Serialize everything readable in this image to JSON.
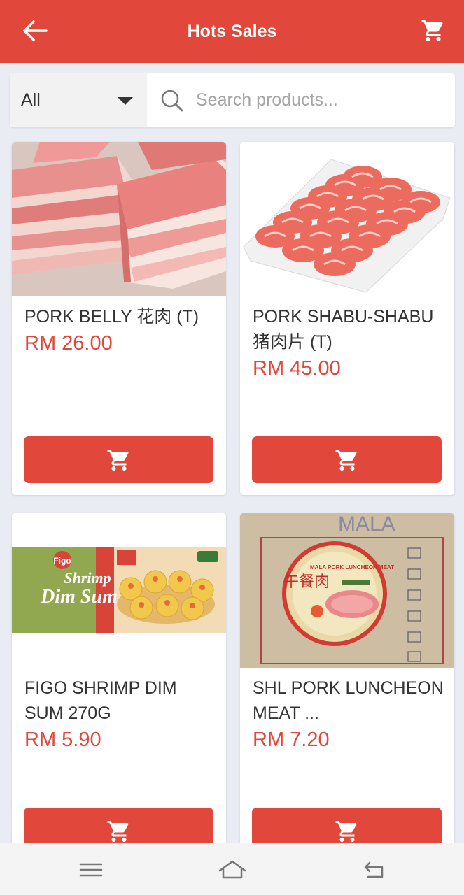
{
  "header": {
    "title": "Hots Sales",
    "back_icon": "arrow-left-icon",
    "cart_icon": "shopping-cart-icon"
  },
  "filter": {
    "category_selected": "All",
    "search_placeholder": "Search products..."
  },
  "products": [
    {
      "name": "PORK BELLY 花肉 (T)",
      "price": "RM 26.00"
    },
    {
      "name": "PORK SHABU-SHABU 猪肉片 (T)",
      "price": "RM 45.00"
    },
    {
      "name": "FIGO SHRIMP DIM SUM  270G",
      "price": "RM 5.90"
    },
    {
      "name": "SHL PORK LUNCHEON MEAT ...",
      "price": "RM 7.20"
    }
  ],
  "product_images": {
    "figo_label_line1": "Shrimp",
    "figo_label_line2": "Dim Sum",
    "figo_brand": "Figo",
    "mala_box_text": "MALA",
    "mala_can_title": "MALA PORK LUNCHEON MEAT",
    "mala_can_chinese": "午餐肉"
  },
  "colors": {
    "primary": "#e1473b",
    "background": "#e9ecf3"
  },
  "system_nav": {
    "menu_icon": "menu-icon",
    "home_icon": "home-icon",
    "back_icon": "back-icon"
  }
}
